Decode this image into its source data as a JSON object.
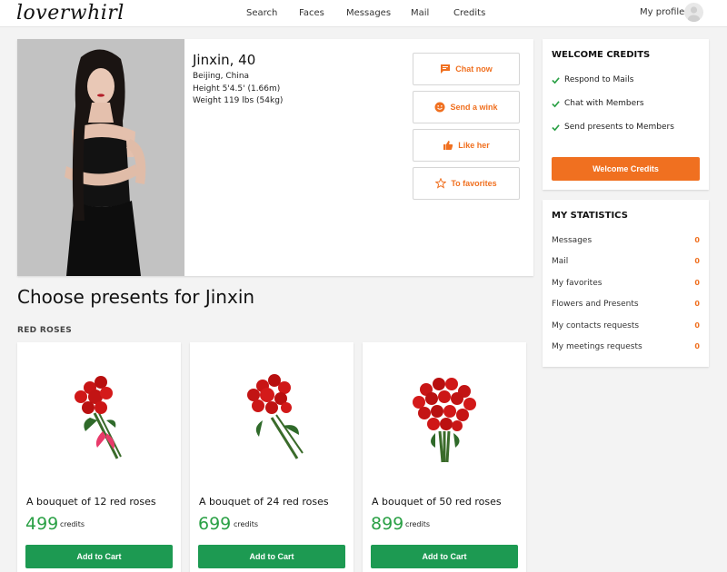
{
  "header": {
    "logo": "loverwhirl",
    "nav": [
      "Search",
      "Faces",
      "Messages",
      "Mail",
      "Credits"
    ],
    "my_profile": "My profile"
  },
  "profile": {
    "name_age": "Jinxin, 40",
    "location": "Beijing, China",
    "height": "Height 5'4.5' (1.66m)",
    "weight": "Weight 119 lbs (54kg)",
    "actions": [
      {
        "label": "Chat now",
        "icon": "chat-icon"
      },
      {
        "label": "Send a wink",
        "icon": "smile-icon"
      },
      {
        "label": "Like her",
        "icon": "thumbs-up-icon"
      },
      {
        "label": "To favorites",
        "icon": "star-icon"
      }
    ]
  },
  "presents": {
    "heading": "Choose presents for Jinxin",
    "section": "RED ROSES",
    "items": [
      {
        "title": "A bouquet of 12 red roses",
        "price": "499",
        "credits_label": "credits",
        "button": "Add to Cart"
      },
      {
        "title": "A bouquet of 24 red roses",
        "price": "699",
        "credits_label": "credits",
        "button": "Add to Cart"
      },
      {
        "title": "A bouquet of 50 red roses",
        "price": "899",
        "credits_label": "credits",
        "button": "Add to Cart"
      }
    ]
  },
  "welcome": {
    "title": "WELCOME CREDITS",
    "items": [
      "Respond to Mails",
      "Chat with Members",
      "Send presents to Members"
    ],
    "button": "Welcome Credits"
  },
  "stats": {
    "title": "MY STATISTICS",
    "rows": [
      {
        "label": "Messages",
        "value": "0"
      },
      {
        "label": "Mail",
        "value": "0"
      },
      {
        "label": "My favorites",
        "value": "0"
      },
      {
        "label": "Flowers and Presents",
        "value": "0"
      },
      {
        "label": "My contacts requests",
        "value": "0"
      },
      {
        "label": "My meetings requests",
        "value": "0"
      }
    ]
  },
  "colors": {
    "accent_orange": "#f07020",
    "green_button": "#1d9a52",
    "price_green": "#2aa045",
    "check_green": "#2aa045"
  }
}
